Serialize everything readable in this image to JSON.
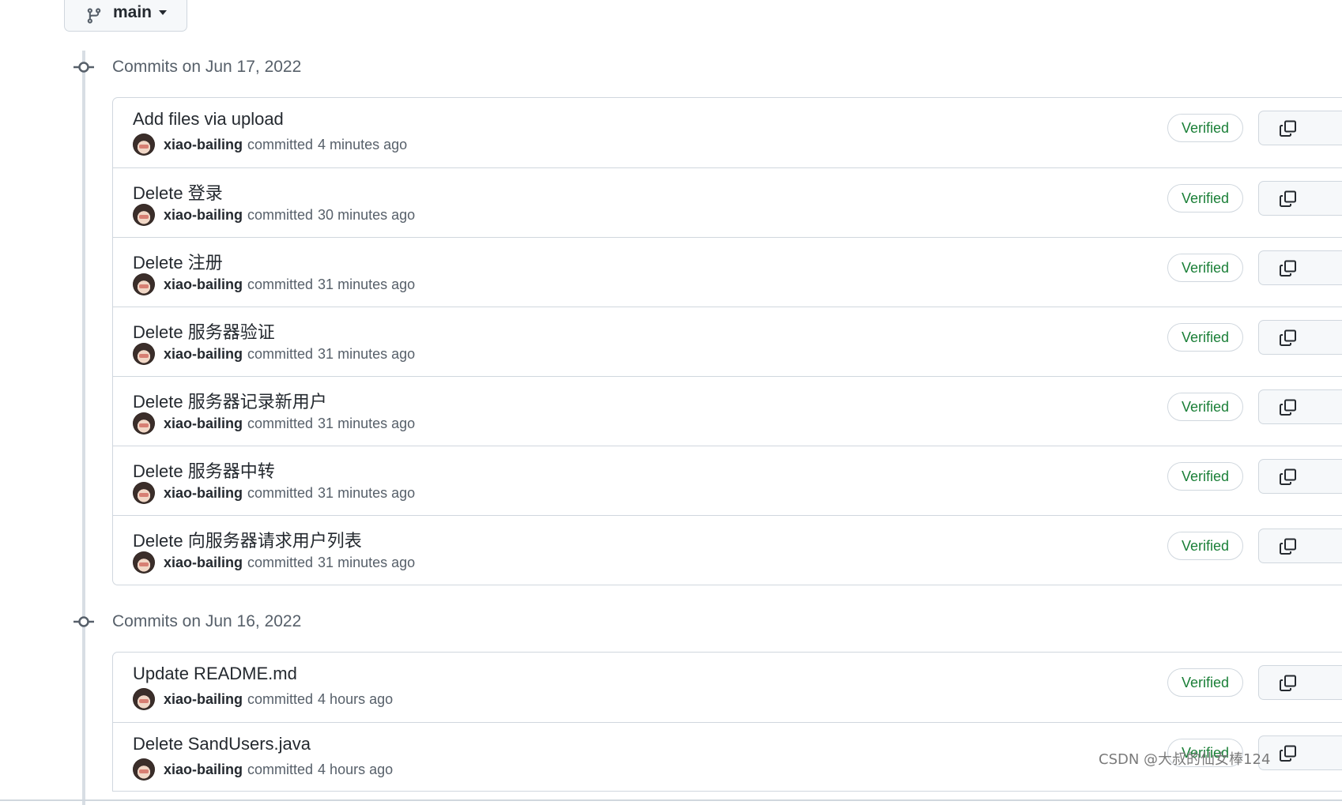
{
  "branch": {
    "name": "main",
    "icon": "git-branch-icon",
    "caret_icon": "triangle-down-icon"
  },
  "days": [
    {
      "heading": "Commits on Jun 17, 2022",
      "commits": [
        {
          "title": "Add files via upload",
          "author": "xiao-bailing",
          "action": "committed",
          "time": "4 minutes ago",
          "badge": "Verified"
        },
        {
          "title": "Delete 登录",
          "author": "xiao-bailing",
          "action": "committed",
          "time": "30 minutes ago",
          "badge": "Verified"
        },
        {
          "title": "Delete 注册",
          "author": "xiao-bailing",
          "action": "committed",
          "time": "31 minutes ago",
          "badge": "Verified"
        },
        {
          "title": "Delete 服务器验证",
          "author": "xiao-bailing",
          "action": "committed",
          "time": "31 minutes ago",
          "badge": "Verified"
        },
        {
          "title": "Delete 服务器记录新用户",
          "author": "xiao-bailing",
          "action": "committed",
          "time": "31 minutes ago",
          "badge": "Verified"
        },
        {
          "title": "Delete 服务器中转",
          "author": "xiao-bailing",
          "action": "committed",
          "time": "31 minutes ago",
          "badge": "Verified"
        },
        {
          "title": "Delete 向服务器请求用户列表",
          "author": "xiao-bailing",
          "action": "committed",
          "time": "31 minutes ago",
          "badge": "Verified"
        }
      ]
    },
    {
      "heading": "Commits on Jun 16, 2022",
      "commits": [
        {
          "title": "Update README.md",
          "author": "xiao-bailing",
          "action": "committed",
          "time": "4 hours ago",
          "badge": "Verified"
        },
        {
          "title": "Delete SandUsers.java",
          "author": "xiao-bailing",
          "action": "committed",
          "time": "4 hours ago",
          "badge": "Verified"
        }
      ]
    }
  ],
  "icons": {
    "commit_node": "git-commit-icon",
    "copy": "copy-icon"
  },
  "watermark": "CSDN @大叔的仙女棒124",
  "colors": {
    "verified": "#1a7f37",
    "border": "#d0d7de",
    "muted": "#57606a",
    "text": "#24292f"
  }
}
